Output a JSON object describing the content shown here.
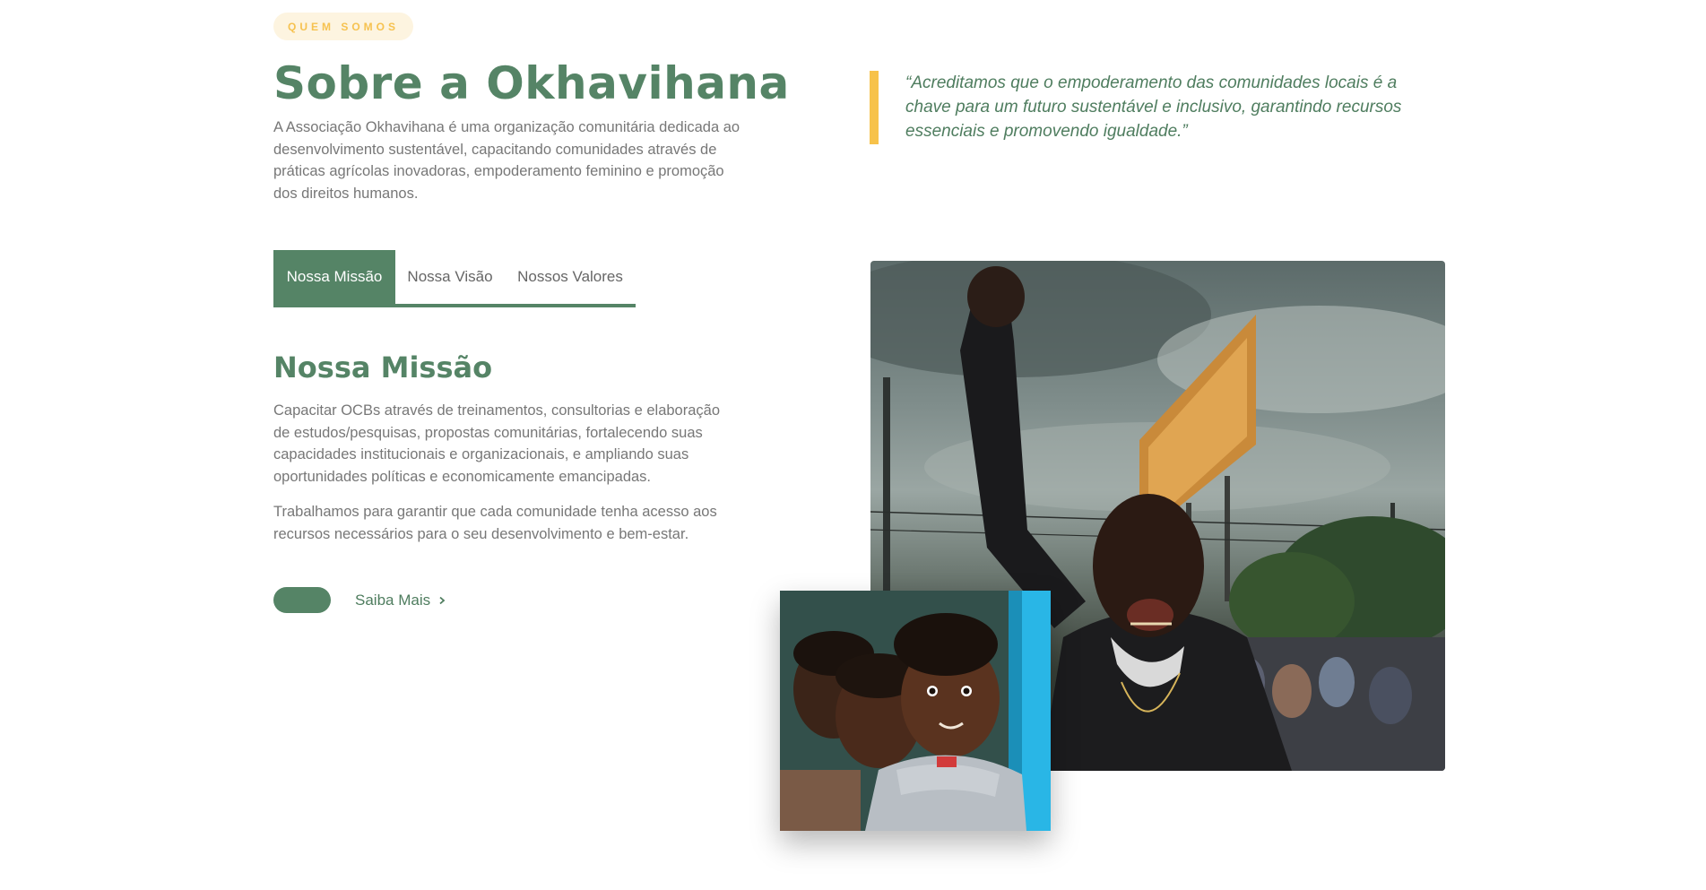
{
  "section": {
    "badge": "QUEM SOMOS",
    "title": "Sobre a Okhavihana",
    "intro": "A Associação Okhavihana é uma organização comunitária dedicada ao desenvolvimento sustentável, capacitando comunidades através de práticas agrícolas inovadoras, empoderamento feminino e promoção dos direitos humanos."
  },
  "quote": {
    "text": "“Acreditamos que o empoderamento das comunidades locais é a chave para um futuro sustentável e inclusivo, garantindo recursos essenciais e promovendo igualdade.”"
  },
  "tabs": [
    {
      "label": "Nossa Missão",
      "active": true
    },
    {
      "label": "Nossa Visão",
      "active": false
    },
    {
      "label": "Nossos Valores",
      "active": false
    }
  ],
  "content": {
    "heading": "Nossa Missão",
    "paragraph1": "Capacitar OCBs através de treinamentos, consultorias e elaboração de estudos/pesquisas, propostas comunitárias, fortalecendo suas capacidades institucionais e organizacionais, e ampliando suas oportunidades políticas e economicamente emancipadas.",
    "paragraph2": "Trabalhamos para garantir que cada comunidade tenha acesso aos recursos necessários para o seu desenvolvimento e bem-estar.",
    "more_link": "Saiba Mais",
    "more_icon": "chevron-right-icon"
  },
  "colors": {
    "primary": "#558466",
    "accent": "#f7c24a",
    "badge_bg": "#fdf4e0",
    "text": "#777777"
  }
}
